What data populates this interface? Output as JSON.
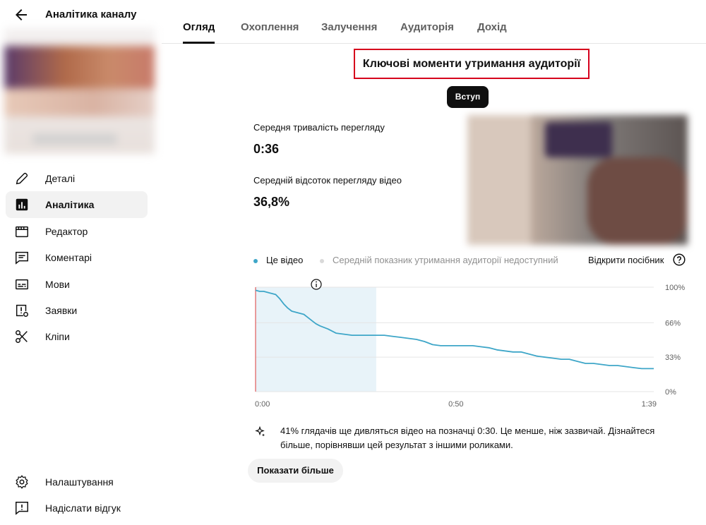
{
  "sidebar": {
    "title": "Аналітика каналу",
    "items": [
      {
        "label": "Деталі",
        "icon": "pencil-icon"
      },
      {
        "label": "Аналітика",
        "icon": "analytics-icon",
        "active": true
      },
      {
        "label": "Редактор",
        "icon": "editor-icon"
      },
      {
        "label": "Коментарі",
        "icon": "comments-icon"
      },
      {
        "label": "Мови",
        "icon": "subtitles-icon"
      },
      {
        "label": "Заявки",
        "icon": "claims-icon"
      },
      {
        "label": "Кліпи",
        "icon": "scissors-icon"
      }
    ],
    "bottom": [
      {
        "label": "Налаштування",
        "icon": "gear-icon"
      },
      {
        "label": "Надіслати відгук",
        "icon": "feedback-icon"
      }
    ]
  },
  "tabs": [
    "Огляд",
    "Охоплення",
    "Залучення",
    "Аудиторія",
    "Дохід"
  ],
  "active_tab": "Огляд",
  "retention": {
    "title": "Ключові моменти утримання аудиторії",
    "chip": "Вступ",
    "avg_duration_label": "Середня тривалість перегляду",
    "avg_duration_value": "0:36",
    "avg_percent_label": "Середній відсоток перегляду відео",
    "avg_percent_value": "36,8%",
    "legend_this_video": "Це відео",
    "legend_average": "Середній показник утримання аудиторії недоступний",
    "guide_link": "Відкрити посібник",
    "insight": "41% глядачів ще дивляться відео на позначці 0:30. Це менше, ніж зазвичай. Дізнайтеся більше, порівнявши цей результат з іншими роликами.",
    "show_more": "Показати більше"
  },
  "colors": {
    "line": "#3ea6c8",
    "highlight": "#e8f3f9",
    "marker": "#e05a5a",
    "title_border": "#d6001c"
  },
  "chart_data": {
    "type": "line",
    "x_labels": [
      "0:00",
      "0:50",
      "1:39"
    ],
    "y_labels": [
      "100%",
      "66%",
      "33%",
      "0%"
    ],
    "xlim": [
      0,
      99
    ],
    "ylim": [
      0,
      100
    ],
    "highlight_range": [
      0,
      30
    ],
    "series": [
      {
        "x": [
          0,
          1,
          2,
          3,
          4,
          5,
          6,
          7,
          8,
          9,
          10,
          11,
          12,
          13,
          14,
          15,
          16,
          18,
          20,
          22,
          24,
          26,
          28,
          30,
          32,
          34,
          36,
          38,
          40,
          42,
          44,
          46,
          48,
          50,
          52,
          54,
          56,
          58,
          60,
          62,
          64,
          66,
          68,
          70,
          72,
          74,
          76,
          78,
          80,
          82,
          84,
          86,
          88,
          90,
          92,
          94,
          96,
          98,
          99
        ],
        "y": [
          97,
          96,
          96,
          95,
          94,
          93,
          89,
          84,
          80,
          77,
          76,
          75,
          74,
          71,
          68,
          65,
          63,
          60,
          56,
          55,
          54,
          54,
          54,
          54,
          54,
          53,
          52,
          51,
          50,
          48,
          45,
          44,
          44,
          44,
          44,
          44,
          43,
          42,
          40,
          39,
          38,
          38,
          36,
          34,
          33,
          32,
          31,
          31,
          29,
          27,
          27,
          26,
          25,
          25,
          24,
          23,
          22,
          22,
          22
        ]
      }
    ]
  }
}
